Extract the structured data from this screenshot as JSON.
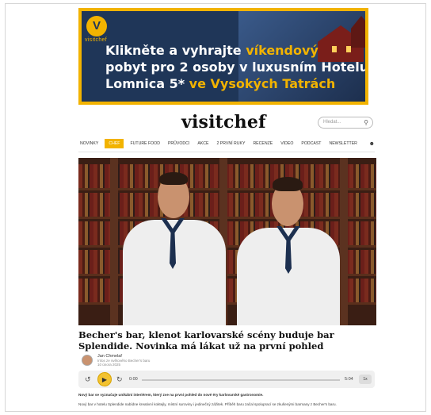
{
  "banner": {
    "logo_mark": "V",
    "logo_word": "visitchef",
    "line1_part1": "Klikněte a vyhrajte",
    "line1_part2": "víkendový",
    "line2": "pobyt pro 2 osoby v luxusním Hotelu",
    "line3_part1": "Lomnica 5*",
    "line3_part2": "ve Vysokých Tatrách",
    "accent_color": "#f2b300",
    "bg_color": "#1f3658"
  },
  "header": {
    "brand": "visitchef",
    "search_placeholder": "Hledat...",
    "search_icon": "search-icon",
    "user_icon": "user-icon"
  },
  "nav": {
    "items": [
      "NOVINKY",
      "CHEF",
      "FUTURE FOOD",
      "PRŮVODCI",
      "AKCE",
      "2 PRVNÍ RUKY",
      "RECENZE",
      "VIDEO",
      "PODCAST",
      "NEWSLETTER"
    ],
    "active_index": 1
  },
  "article": {
    "headline": "Becher's bar, klenot karlovarské scény buduje bar Splendide. Novinka má lákat už na první pohled",
    "author": "Jan Chmelař",
    "author_sub": "Infos ze světového Becher's baru",
    "date": "10 února 2025",
    "intro": "Nový bar se vyznačuje unikátní interiérem, který zve na první pohled do nové éry karlovarské gastronomie.",
    "body": "Nový bar v hotelu Splendide nabídne kreativní koktejly, místní suroviny i jedinečný zážitek. Příběh baru začal spoluprací se zkušenými barmany z Becher's baru."
  },
  "player": {
    "time_start": "0:00",
    "time_end": "5:04",
    "speed": "1x",
    "play_icon": "play-icon",
    "rewind_icon": "rewind-icon",
    "forward_icon": "forward-icon",
    "progress": 0
  }
}
